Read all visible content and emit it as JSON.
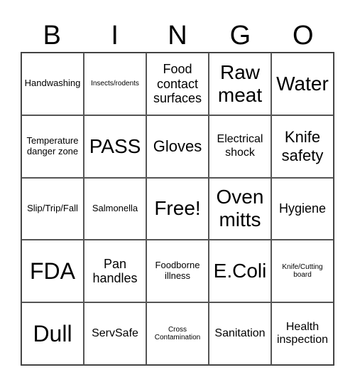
{
  "header": [
    "B",
    "I",
    "N",
    "G",
    "O"
  ],
  "cells": [
    [
      "Handwashing",
      "Insects/rodents",
      "Food contact surfaces",
      "Raw meat",
      "Water"
    ],
    [
      "Temperature danger zone",
      "PASS",
      "Gloves",
      "Electrical shock",
      "Knife safety"
    ],
    [
      "Slip/Trip/Fall",
      "Salmonella",
      "Free!",
      "Oven mitts",
      "Hygiene"
    ],
    [
      "FDA",
      "Pan handles",
      "Foodborne illness",
      "E.Coli",
      "Knife/Cutting board"
    ],
    [
      "Dull",
      "ServSafe",
      "Cross Contamination",
      "Sanitation",
      "Health inspection"
    ]
  ]
}
